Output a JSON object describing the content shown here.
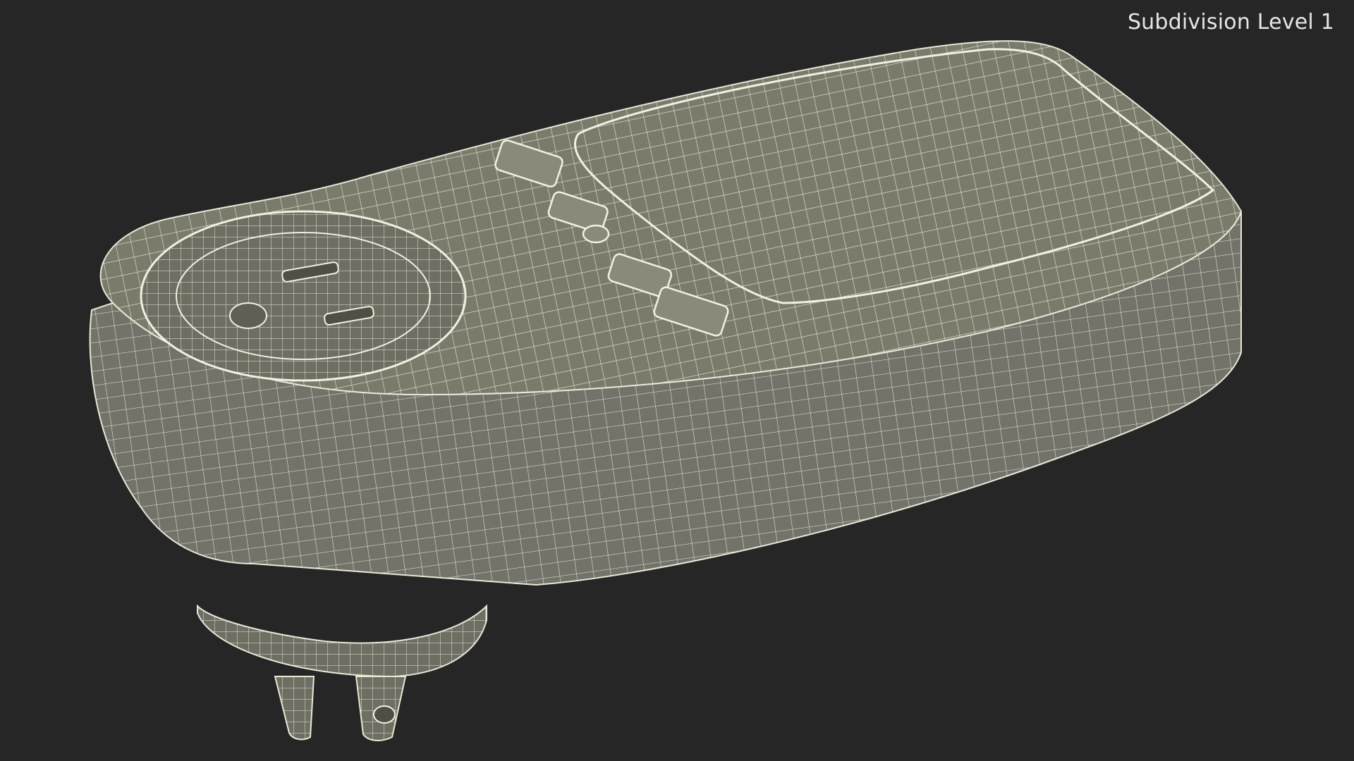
{
  "viewport": {
    "label": "Subdivision Level 1"
  },
  "colors": {
    "background": "#262626",
    "surface": "#7b7b6c",
    "surface_shadow": "#5f5f53",
    "wire": "#e9e7d6",
    "label": "#e6e6e6"
  },
  "model": {
    "subject": "plug-in power meter wireframe",
    "display": "wireframe-on-shaded"
  }
}
